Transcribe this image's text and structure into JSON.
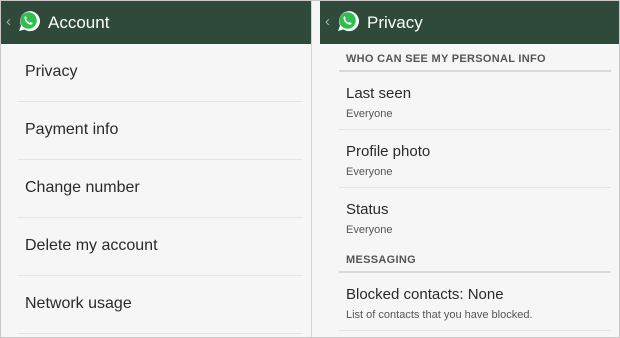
{
  "account": {
    "title": "Account",
    "back": "‹",
    "logo_icon": "whatsapp-logo-icon",
    "items": [
      {
        "label": "Privacy"
      },
      {
        "label": "Payment info"
      },
      {
        "label": "Change number"
      },
      {
        "label": "Delete my account"
      },
      {
        "label": "Network usage"
      }
    ]
  },
  "privacy": {
    "title": "Privacy",
    "back": "‹",
    "logo_icon": "whatsapp-logo-icon",
    "section_personal": "WHO CAN SEE MY PERSONAL INFO",
    "personal_rows": [
      {
        "title": "Last seen",
        "value": "Everyone"
      },
      {
        "title": "Profile photo",
        "value": "Everyone"
      },
      {
        "title": "Status",
        "value": "Everyone"
      }
    ],
    "section_messaging": "MESSAGING",
    "blocked": {
      "title": "Blocked contacts: None",
      "description": "List of contacts that you have blocked."
    }
  },
  "colors": {
    "action_bar": "#2f4a3b",
    "logo_green": "#2fbe4f",
    "background": "#f6f6f6"
  }
}
